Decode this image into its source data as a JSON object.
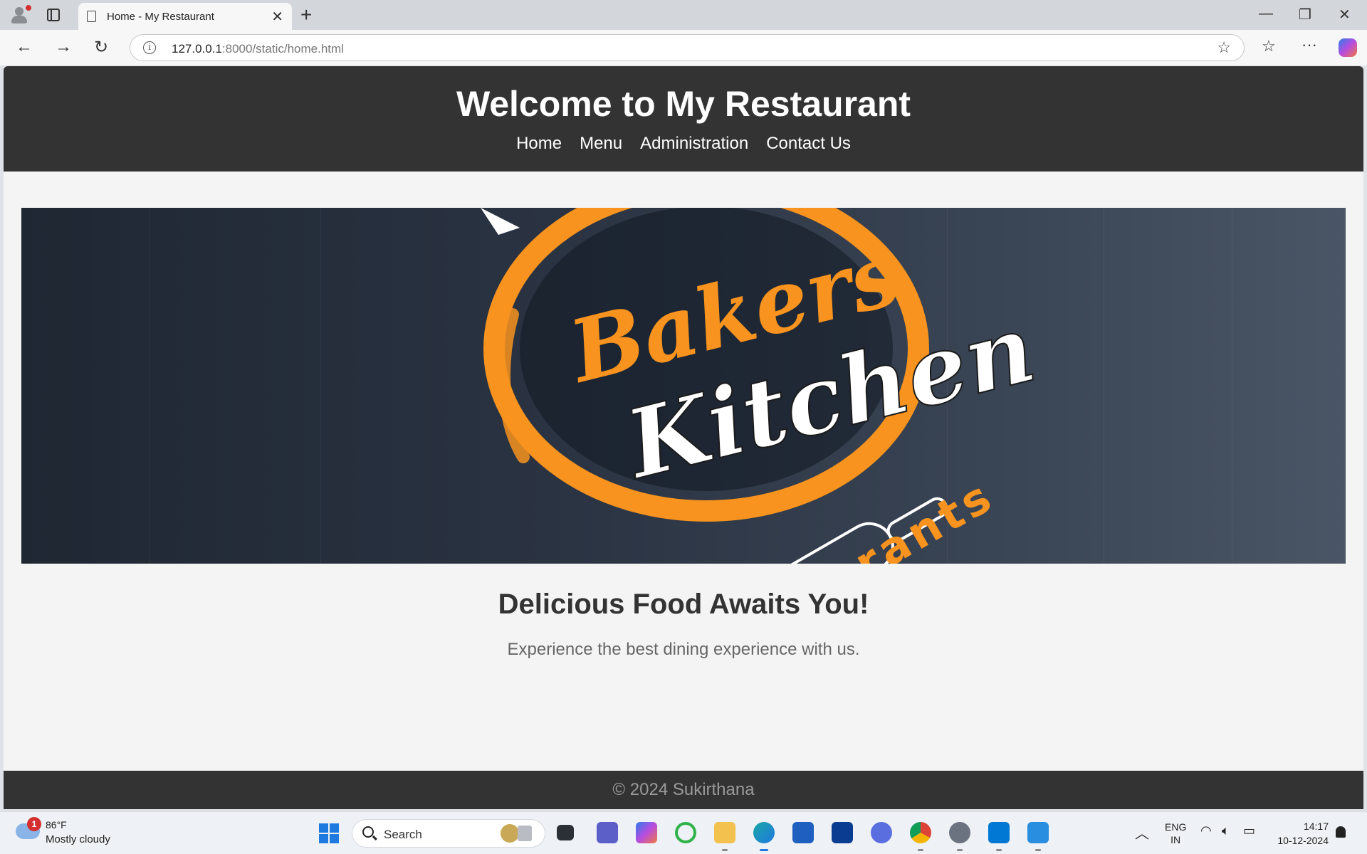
{
  "browser": {
    "tab_title": "Home - My Restaurant",
    "url_host": "127.0.0.1",
    "url_rest": ":8000/static/home.html",
    "icons": [
      "profile-icon",
      "tab-actions-icon",
      "page-icon",
      "close-icon",
      "new-tab-icon",
      "minimize-icon",
      "restore-icon",
      "close-window-icon",
      "back-icon",
      "forward-icon",
      "refresh-icon",
      "site-info-icon",
      "favorite-star-icon",
      "favorites-icon",
      "more-icon",
      "copilot-icon"
    ]
  },
  "site": {
    "title": "Welcome to My Restaurant",
    "nav": [
      "Home",
      "Menu",
      "Administration",
      "Contact Us"
    ],
    "hero": {
      "logo_line1": "Bakers",
      "logo_line2": "Kitchen",
      "logo_line3": "Restaurants"
    },
    "heading": "Delicious Food Awaits You!",
    "tagline": "Experience the best dining experience with us.",
    "footer": "© 2024 Sukirthana",
    "colors": {
      "header_bg": "#333333",
      "page_bg": "#f4f4f4",
      "logo_orange": "#f7931e"
    }
  },
  "taskbar": {
    "weather_badge": "1",
    "temperature": "86°F",
    "condition": "Mostly cloudy",
    "search_label": "Search",
    "lang_line1": "ENG",
    "lang_line2": "IN",
    "time": "14:17",
    "date": "10-12-2024",
    "apps": [
      "task-view-icon",
      "teams-icon",
      "copilot-icon",
      "sync-icon",
      "file-explorer-icon",
      "edge-icon",
      "store-icon",
      "l-app-icon",
      "vpn-icon",
      "chrome-icon",
      "settings-icon",
      "vscode-icon",
      "paint-icon"
    ]
  }
}
